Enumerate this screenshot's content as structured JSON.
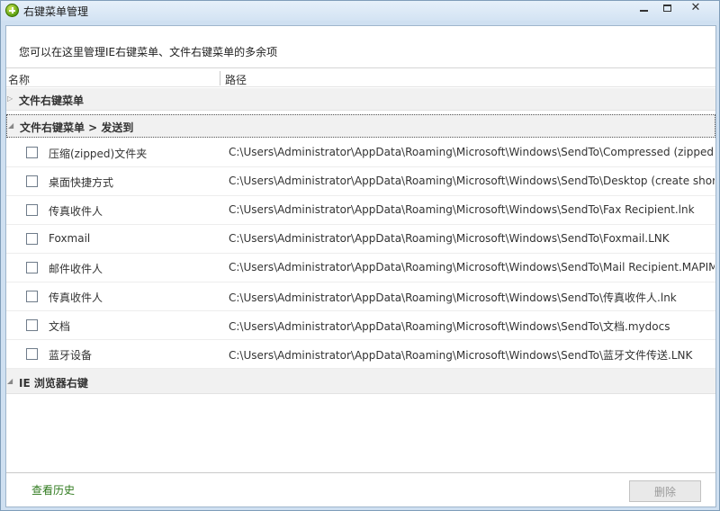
{
  "window": {
    "title": "右键菜单管理",
    "min_glyph": "",
    "close_glyph": "✕"
  },
  "description": "您可以在这里管理IE右键菜单、文件右键菜单的多余项",
  "columns": {
    "name": "名称",
    "path": "路径"
  },
  "groups": [
    {
      "label": "文件右键菜单",
      "expanded": false,
      "arrow": "▷"
    },
    {
      "label": "文件右键菜单 > 发送到",
      "expanded": true,
      "arrow": "◢"
    },
    {
      "label": "IE 浏览器右键",
      "expanded": true,
      "arrow": "◢"
    }
  ],
  "items": [
    {
      "name": "压缩(zipped)文件夹",
      "path": "C:\\Users\\Administrator\\AppData\\Roaming\\Microsoft\\Windows\\SendTo\\Compressed (zipped) Folder.ZFSendToTarget",
      "checked": false
    },
    {
      "name": "桌面快捷方式",
      "path": "C:\\Users\\Administrator\\AppData\\Roaming\\Microsoft\\Windows\\SendTo\\Desktop (create shortcut).DeskLink",
      "checked": false
    },
    {
      "name": "传真收件人",
      "path": "C:\\Users\\Administrator\\AppData\\Roaming\\Microsoft\\Windows\\SendTo\\Fax Recipient.lnk",
      "checked": false
    },
    {
      "name": "Foxmail",
      "path": "C:\\Users\\Administrator\\AppData\\Roaming\\Microsoft\\Windows\\SendTo\\Foxmail.LNK",
      "checked": false
    },
    {
      "name": "邮件收件人",
      "path": "C:\\Users\\Administrator\\AppData\\Roaming\\Microsoft\\Windows\\SendTo\\Mail Recipient.MAPIMail",
      "checked": false
    },
    {
      "name": "传真收件人",
      "path": "C:\\Users\\Administrator\\AppData\\Roaming\\Microsoft\\Windows\\SendTo\\传真收件人.lnk",
      "checked": false
    },
    {
      "name": "文档",
      "path": "C:\\Users\\Administrator\\AppData\\Roaming\\Microsoft\\Windows\\SendTo\\文档.mydocs",
      "checked": false
    },
    {
      "name": "蓝牙设备",
      "path": "C:\\Users\\Administrator\\AppData\\Roaming\\Microsoft\\Windows\\SendTo\\蓝牙文件传送.LNK",
      "checked": false
    }
  ],
  "footer": {
    "history_link": "查看历史",
    "delete_button": "删除"
  },
  "colors": {
    "link_green": "#2f7a1e",
    "group_bg": "#f1f1f1",
    "title_bg": "#d3e3f3"
  }
}
